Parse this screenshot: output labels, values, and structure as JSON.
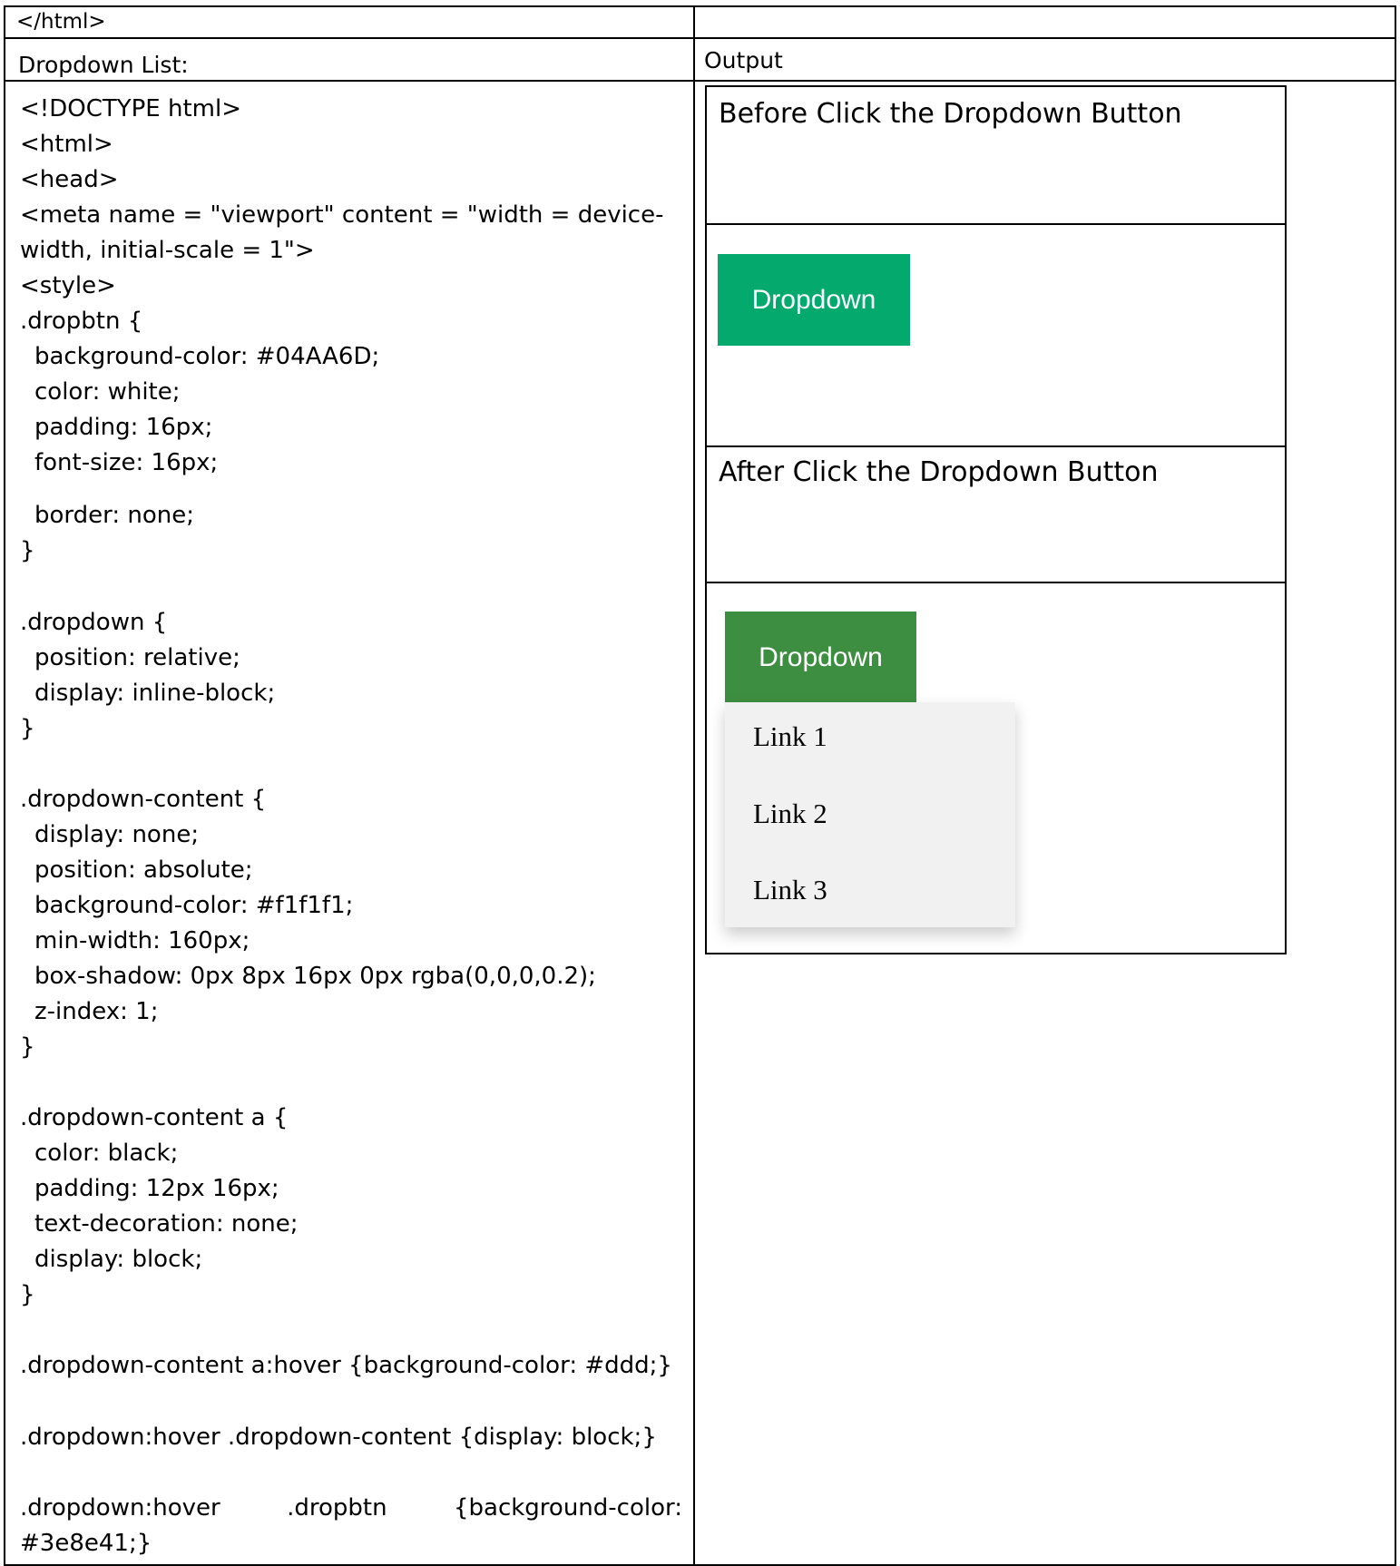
{
  "header_row": {
    "left_text": "</html>",
    "right_text": ""
  },
  "title_row": {
    "left_title": "Dropdown List:",
    "right_title": "Output"
  },
  "code_lines": [
    "<!DOCTYPE html>",
    "<html>",
    "<head>",
    "<meta name = \"viewport\" content = \"width = device-",
    "width, initial-scale = 1\">",
    "<style>",
    ".dropbtn {",
    "background-color: #04AA6D;",
    "color: white;",
    "padding: 16px;",
    "font-size: 16px;",
    "border: none;",
    "}",
    ".dropdown {",
    "position: relative;",
    "display: inline-block;",
    "}",
    ".dropdown-content {",
    "display: none;",
    "position: absolute;",
    "background-color: #f1f1f1;",
    "min-width: 160px;",
    "box-shadow: 0px 8px 16px 0px rgba(0,0,0,0.2);",
    "z-index: 1;",
    "}",
    ".dropdown-content a {",
    "color: black;",
    "padding: 12px 16px;",
    "text-decoration: none;",
    "display: block;",
    "}",
    ".dropdown-content a:hover {background-color: #ddd;}",
    ".dropdown:hover .dropdown-content {display: block;}",
    ".dropdown:hover",
    ".dropbtn",
    "{background-color:",
    "#3e8e41;}"
  ],
  "output": {
    "before_heading": "Before Click the Dropdown Button",
    "after_heading": "After Click the Dropdown Button",
    "button_label": "Dropdown",
    "links": [
      "Link 1",
      "Link 2",
      "Link 3"
    ]
  },
  "colors": {
    "button_default": "#04AA6D",
    "button_hover": "#3e8e41",
    "dropdown_bg": "#f1f1f1"
  }
}
